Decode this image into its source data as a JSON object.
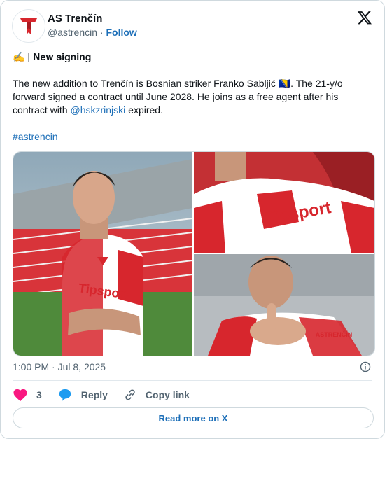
{
  "account": {
    "name": "AS Trenčín",
    "handle": "@astrencin",
    "separator": "·",
    "follow": "Follow"
  },
  "tweet": {
    "line1": "✍️ | 𝐍𝐞𝐰 𝐬𝐢𝐠𝐧𝐢𝐧𝐠",
    "body_prefix": "The new addition to Trenčín is Bosnian striker Franko Sabljić 🇧🇦. The 21-y/o forward signed a contract until June 2028. He joins as a free agent after his contract with ",
    "mention": "@hskzrinjski",
    "body_suffix": " expired.",
    "hashtag": "#astrencin"
  },
  "media": {
    "photos": [
      {
        "name": "player-portrait-photo",
        "sponsor": "Tipsport"
      },
      {
        "name": "jersey-closeup-photo",
        "sponsor": "Tipsport"
      },
      {
        "name": "player-pointing-photo",
        "sponsor": "ASTRENČÍN"
      }
    ]
  },
  "meta": {
    "time": "1:00 PM",
    "separator": "·",
    "date": "Jul 8, 2025"
  },
  "actions": {
    "likes": "3",
    "reply": "Reply",
    "copy_link": "Copy link"
  },
  "cta": {
    "read_more": "Read more on X"
  },
  "colors": {
    "accent": "#1d6fb8",
    "like": "#f91880",
    "club_red": "#d7262d"
  },
  "icons": [
    "club-logo-icon",
    "x-logo-icon",
    "info-icon",
    "heart-icon",
    "reply-icon",
    "link-icon"
  ]
}
